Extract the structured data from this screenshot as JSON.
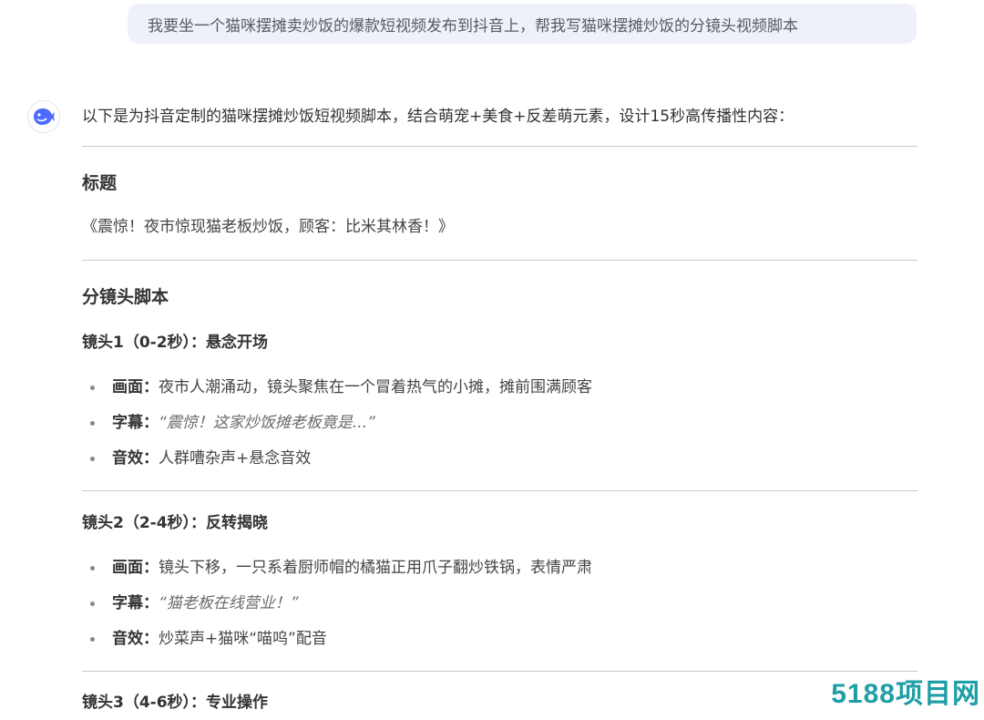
{
  "user_message": "我要坐一个猫咪摆摊卖炒饭的爆款短视频发布到抖音上，帮我写猫咪摆摊炒饭的分镜头视频脚本",
  "assistant": {
    "avatar_icon": "whale-logo-icon",
    "intro": "以下是为抖音定制的猫咪摆摊炒饭短视频脚本，结合萌宠+美食+反差萌元素，设计15秒高传播性内容：",
    "title_heading": "标题",
    "title_text": "《震惊！夜市惊现猫老板炒饭，顾客：比米其林香！》",
    "script_heading": "分镜头脚本",
    "shots": [
      {
        "title": "镜头1（0-2秒）：悬念开场",
        "items": [
          {
            "label": "画面：",
            "text": "夜市人潮涌动，镜头聚焦在一个冒着热气的小摊，摊前围满顾客",
            "italic": false
          },
          {
            "label": "字幕：",
            "text": "“震惊！这家炒饭摊老板竟是...”",
            "italic": true
          },
          {
            "label": "音效：",
            "text": "人群嘈杂声+悬念音效",
            "italic": false
          }
        ]
      },
      {
        "title": "镜头2（2-4秒）：反转揭晓",
        "items": [
          {
            "label": "画面：",
            "text": "镜头下移，一只系着厨师帽的橘猫正用爪子翻炒铁锅，表情严肃",
            "italic": false
          },
          {
            "label": "字幕：",
            "text": "“猫老板在线营业！”",
            "italic": true
          },
          {
            "label": "音效：",
            "text": "炒菜声+猫咪“喵呜”配音",
            "italic": false
          }
        ]
      },
      {
        "title": "镜头3（4-6秒）：专业操作"
      }
    ]
  },
  "watermark": "5188项目网",
  "colors": {
    "bubble_bg": "#eef1f9",
    "avatar_blue": "#4d6bfe",
    "watermark": "#1e9ea6",
    "divider": "#c9c9c9"
  }
}
